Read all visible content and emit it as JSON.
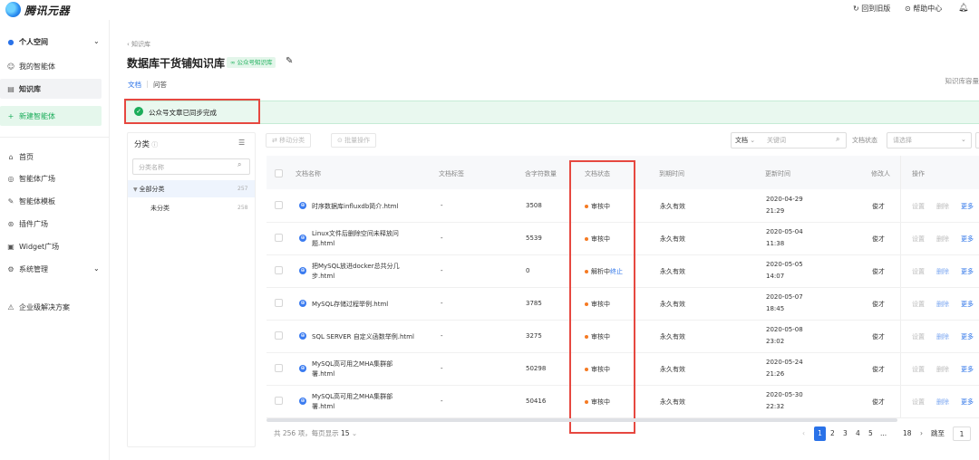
{
  "header": {
    "logo_text": "腾讯元器",
    "links": [
      {
        "icon": "refresh-icon",
        "label": "回到旧版"
      },
      {
        "icon": "help-icon",
        "label": "帮助中心"
      }
    ]
  },
  "sidebar": {
    "workspace": "个人空间",
    "items": [
      {
        "icon": "agent-icon",
        "label": "我的智能体"
      },
      {
        "icon": "doc-icon",
        "label": "知识库"
      }
    ],
    "new_agent": "新建智能体",
    "nav": [
      {
        "icon": "home-icon",
        "label": "首页"
      },
      {
        "icon": "square-icon",
        "label": "智能体广场"
      },
      {
        "icon": "template-icon",
        "label": "智能体模板"
      },
      {
        "icon": "plugin-icon",
        "label": "插件广场"
      },
      {
        "icon": "widget-icon",
        "label": "Widget广场"
      },
      {
        "icon": "gear-icon",
        "label": "系统管理"
      },
      {
        "icon": "enterprise-icon",
        "label": "企业级解决方案"
      }
    ]
  },
  "page": {
    "breadcrumb": "知识库",
    "title": "数据库干货铺知识库",
    "badge": "公众号知识库",
    "tabs": [
      "文档",
      "问答"
    ],
    "capacity_label": "知识库容量",
    "banner": "公众号文章已同步完成"
  },
  "category": {
    "title": "分类",
    "search_placeholder": "分类名称",
    "items": [
      {
        "label": "全部分类",
        "count": "257"
      },
      {
        "label": "未分类",
        "count": "258"
      }
    ]
  },
  "toolbar": {
    "move": "移动分类",
    "batch": "批量操作",
    "type_select": "文档",
    "keyword_placeholder": "关键词",
    "status_label": "文档状态",
    "status_placeholder": "请选择"
  },
  "table": {
    "columns": [
      "文档名称",
      "文档标签",
      "含字符数量",
      "文档状态",
      "到期时间",
      "更新时间",
      "修改人",
      "操作"
    ],
    "rows": [
      {
        "name": [
          "时序数据库influxdb简介.html"
        ],
        "tag": "-",
        "chars": "3508",
        "status": "审核中",
        "stop": "",
        "expire": "永久有效",
        "date": "2020-04-29",
        "time": "21:29",
        "user": "俊才",
        "ops": [
          "设置",
          "删除",
          "更多"
        ]
      },
      {
        "name": [
          "Linux文件后删除空间未释放问",
          "题.html"
        ],
        "tag": "-",
        "chars": "5539",
        "status": "审核中",
        "stop": "",
        "expire": "永久有效",
        "date": "2020-05-04",
        "time": "11:38",
        "user": "俊才",
        "ops": [
          "设置",
          "删除",
          "更多"
        ]
      },
      {
        "name": [
          "把MySQL放进docker总共分几",
          "步.html"
        ],
        "tag": "-",
        "chars": "0",
        "status": "解析中",
        "stop": "终止",
        "expire": "永久有效",
        "date": "2020-05-05",
        "time": "14:07",
        "user": "俊才",
        "ops": [
          "设置",
          "删除",
          "更多"
        ]
      },
      {
        "name": [
          "MySQL存储过程举例.html"
        ],
        "tag": "-",
        "chars": "3785",
        "status": "审核中",
        "stop": "",
        "expire": "永久有效",
        "date": "2020-05-07",
        "time": "18:45",
        "user": "俊才",
        "ops": [
          "设置",
          "删除",
          "更多"
        ]
      },
      {
        "name": [
          "SQL SERVER 自定义函数举例.html"
        ],
        "tag": "-",
        "chars": "3275",
        "status": "审核中",
        "stop": "",
        "expire": "永久有效",
        "date": "2020-05-08",
        "time": "23:02",
        "user": "俊才",
        "ops": [
          "设置",
          "删除",
          "更多"
        ]
      },
      {
        "name": [
          "MySQL高可用之MHA集群部",
          "署.html"
        ],
        "tag": "-",
        "chars": "50298",
        "status": "审核中",
        "stop": "",
        "expire": "永久有效",
        "date": "2020-05-24",
        "time": "21:26",
        "user": "俊才",
        "ops": [
          "设置",
          "删除",
          "更多"
        ]
      },
      {
        "name": [
          "MySQL高可用之MHA集群部",
          "署.html"
        ],
        "tag": "-",
        "chars": "50416",
        "status": "审核中",
        "stop": "",
        "expire": "永久有效",
        "date": "2020-05-30",
        "time": "22:32",
        "user": "俊才",
        "ops": [
          "设置",
          "删除",
          "更多"
        ]
      }
    ]
  },
  "pagination": {
    "summary": "共 256 项，每页显示",
    "page_size": "15",
    "pages": [
      "1",
      "2",
      "3",
      "4",
      "5",
      "...",
      "18"
    ],
    "current": "1",
    "jump_label": "跳至",
    "jump_value": "1"
  },
  "colors": {
    "accent": "#2a72e8",
    "success": "#1bad5a",
    "warning": "#f57a23",
    "highlight": "#e64840"
  }
}
